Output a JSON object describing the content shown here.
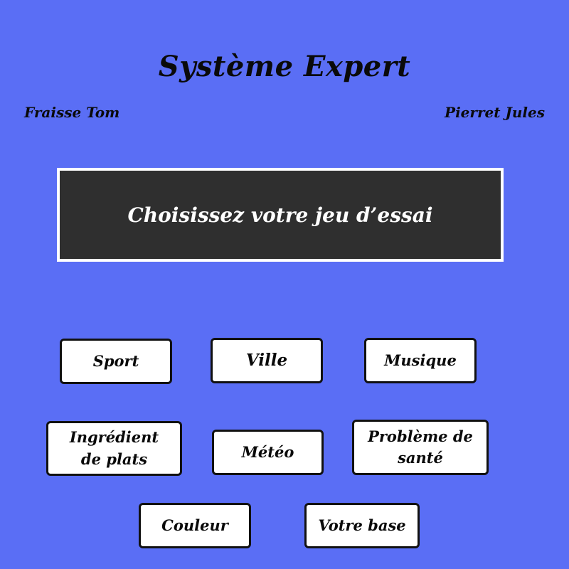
{
  "header": {
    "title": "Système Expert",
    "author_left": "Fraisse Tom",
    "author_right": "Pierret Jules"
  },
  "banner": {
    "text": "Choisissez votre jeu d’essai"
  },
  "buttons": {
    "sport": "Sport",
    "ville": "Ville",
    "musique": "Musique",
    "ingredient_line1": "Ingrédient",
    "ingredient_line2": "de plats",
    "meteo": "Météo",
    "sante_line1": "Problème de",
    "sante_line2": "santé",
    "couleur": "Couleur",
    "votre_base": "Votre base"
  },
  "colors": {
    "background": "#5a6ef5",
    "banner": "#2f2f2f",
    "button_bg": "#ffffff",
    "text": "#0a0a0a"
  }
}
